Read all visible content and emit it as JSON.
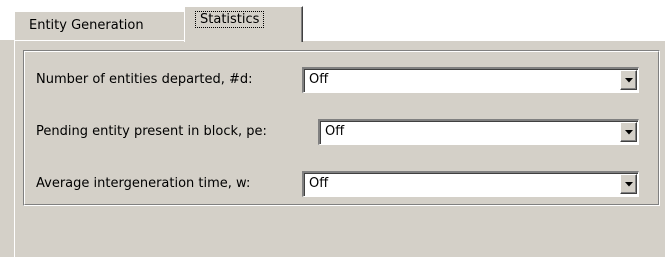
{
  "tabs": [
    {
      "label": "Entity Generation",
      "selected": false
    },
    {
      "label": "Statistics",
      "selected": true
    }
  ],
  "statistics": {
    "fields": [
      {
        "label": "Number of entities departed, #d:",
        "value": "Off"
      },
      {
        "label": "Pending entity present in block, pe:",
        "value": "Off"
      },
      {
        "label": "Average intergeneration time, w:",
        "value": "Off"
      }
    ]
  },
  "icons": {
    "dropdown": "chevron-down-icon"
  },
  "colors": {
    "face": "#d4d0c8",
    "field": "#ffffff",
    "shadow": "#808080",
    "dark_shadow": "#404040",
    "highlight": "#ffffff"
  }
}
